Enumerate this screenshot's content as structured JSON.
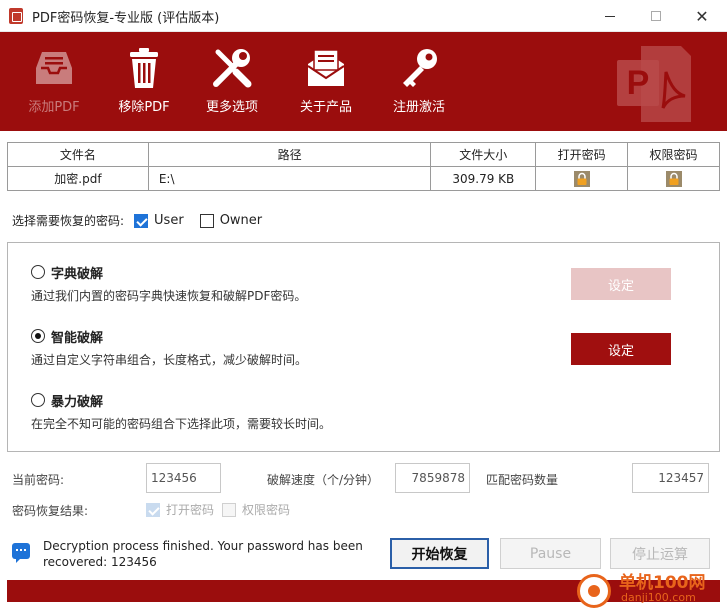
{
  "window": {
    "title": "PDF密码恢复-专业版 (评估版本)",
    "minimize_glyph": "—",
    "close_glyph": "✕"
  },
  "toolbar": {
    "add_label": "添加PDF",
    "remove_label": "移除PDF",
    "more_label": "更多选项",
    "about_label": "关于产品",
    "register_label": "注册激活",
    "add_disabled": true
  },
  "file_table": {
    "headers": [
      "文件名",
      "路径",
      "文件大小",
      "打开密码",
      "权限密码"
    ],
    "rows": [
      {
        "name": "加密.pdf",
        "path": "E:\\",
        "size": "309.79 KB",
        "open_pw": "lock-icon",
        "perm_pw": "lock-icon"
      }
    ]
  },
  "target": {
    "label": "选择需要恢复的密码:",
    "user_label": "User",
    "user_checked": true,
    "owner_label": "Owner",
    "owner_checked": false
  },
  "modes": {
    "dict": {
      "title": "字典破解",
      "desc": "通过我们内置的密码字典快速恢复和破解PDF密码。",
      "selected": false
    },
    "smart": {
      "title": "智能破解",
      "desc": "通过自定义字符串组合，长度格式，减少破解时间。",
      "selected": true
    },
    "brute": {
      "title": "暴力破解",
      "desc": "在完全不知可能的密码组合下选择此项，需要较长时间。",
      "selected": false
    },
    "set_label": "设定"
  },
  "stats": {
    "current_label": "当前密码:",
    "current_value": "123456",
    "speed_label": "破解速度（个/分钟）",
    "speed_value": "7859878",
    "match_label": "匹配密码数量",
    "match_value": "123457"
  },
  "result": {
    "label": "密码恢复结果:",
    "open_label": "打开密码",
    "open_checked": true,
    "perm_label": "权限密码",
    "perm_checked": false
  },
  "status": {
    "message": "Decryption process finished. Your password has been recovered: 123456"
  },
  "actions": {
    "start_label": "开始恢复",
    "pause_label": "Pause",
    "stop_label": "停止运算"
  },
  "progress": {
    "fraction": 1.0
  },
  "watermark": {
    "line1": "单机100网",
    "line2": "danji100.com"
  },
  "colors": {
    "brand_red": "#9b0d0d",
    "button_red": "#a00f0f",
    "checkbox_blue": "#1e73d8",
    "watermark_orange": "#e8641b"
  }
}
